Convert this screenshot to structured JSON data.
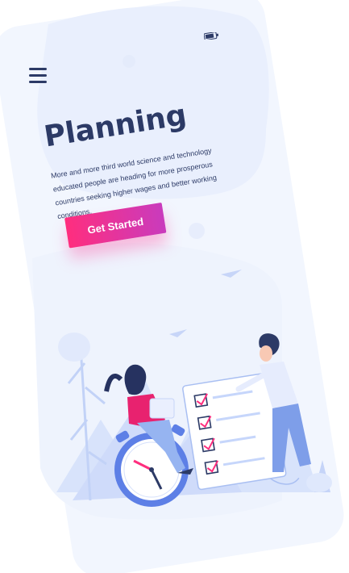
{
  "screen": {
    "title": "Planning",
    "description": "More and more third world science and technology educated people are heading for more prosperous countries seeking higher wages and better working conditions.",
    "cta_label": "Get Started"
  },
  "icons": {
    "menu": "hamburger-menu-icon",
    "battery": "battery-icon"
  },
  "colors": {
    "text": "#2c3a66",
    "accent_start": "#ff2e7e",
    "accent_end": "#c93bbd",
    "panel": "#eef3fd",
    "illustration_blue": "#dfe7fb"
  }
}
